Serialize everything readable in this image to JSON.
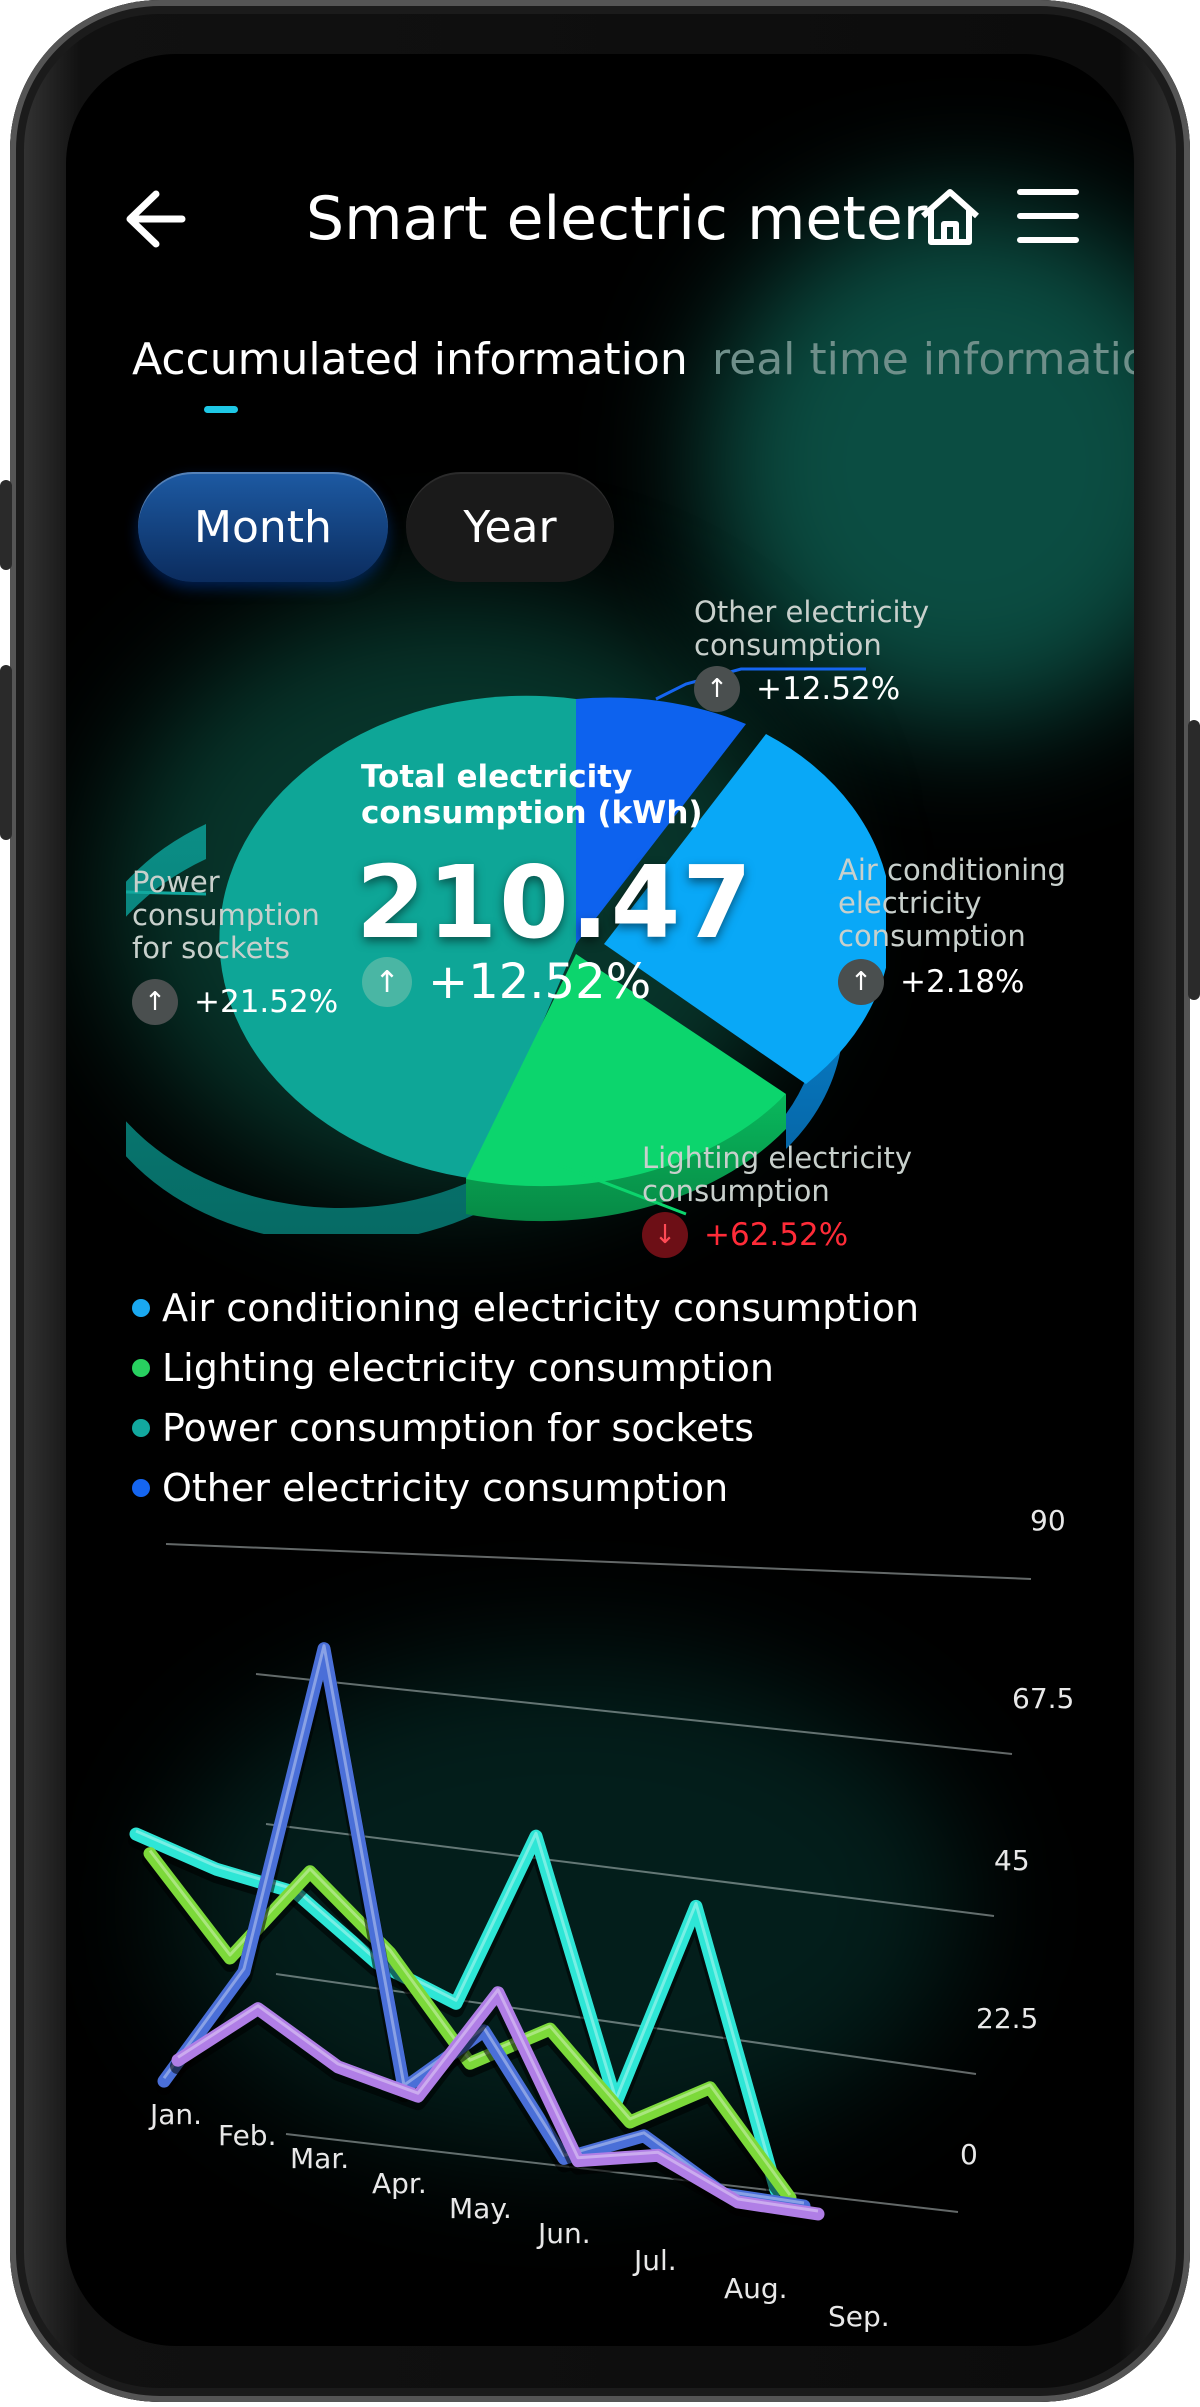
{
  "header": {
    "title": "Smart electric meter"
  },
  "tabs": [
    {
      "label": "Accumulated information",
      "active": true
    },
    {
      "label": "real time information",
      "active": false
    }
  ],
  "period": {
    "month_label": "Month",
    "year_label": "Year",
    "selected": "Month"
  },
  "summary": {
    "title_line1": "Total electricity",
    "title_line2": "consumption (kWh)",
    "value": "210.47",
    "change": "+12.52%"
  },
  "pie": {
    "segments": [
      {
        "name": "Other electricity consumption",
        "label_lines": [
          "Other electricity",
          "consumption"
        ],
        "change": "+12.52%",
        "trend": "up",
        "color": "#0f63f0",
        "share": 0.12
      },
      {
        "name": "Air conditioning electricity consumption",
        "label_lines": [
          "Air conditioning",
          "electricity",
          "consumption"
        ],
        "change": "+2.18%",
        "trend": "up",
        "color": "#08a8f8",
        "share": 0.25
      },
      {
        "name": "Lighting electricity consumption",
        "label_lines": [
          "Lighting electricity",
          "consumption"
        ],
        "change": "+62.52%",
        "trend": "down",
        "color": "#0cd66e",
        "share": 0.2
      },
      {
        "name": "Power consumption for sockets",
        "label_lines": [
          "Power",
          "consumption",
          "for sockets"
        ],
        "change": "+21.52%",
        "trend": "up",
        "color": "#0fa69a",
        "share": 0.43
      }
    ]
  },
  "legend": [
    {
      "label": "Air conditioning electricity consumption",
      "color": "#1aa8f0"
    },
    {
      "label": "Lighting electricity consumption",
      "color": "#28d060"
    },
    {
      "label": "Power consumption for sockets",
      "color": "#12a89e"
    },
    {
      "label": "Other electricity consumption",
      "color": "#1565f0"
    }
  ],
  "chart_data": {
    "type": "line",
    "categories": [
      "Jan.",
      "Feb.",
      "Mar.",
      "Apr.",
      "May.",
      "Jun.",
      "Jul.",
      "Aug.",
      "Sep."
    ],
    "y_ticks": [
      "90",
      "67.5",
      "45",
      "22.5",
      "0"
    ],
    "ylim": [
      0,
      90
    ],
    "series": [
      {
        "color": "#2ee6d6",
        "values": [
          45,
          41,
          39,
          29,
          24,
          55,
          11,
          47,
          0
        ]
      },
      {
        "color": "#7cd93a",
        "values": [
          43,
          27,
          44,
          32,
          15,
          23,
          9,
          17,
          0
        ]
      },
      {
        "color": "#4a6fd8",
        "values": [
          5,
          26,
          84,
          10,
          22,
          2,
          8,
          0,
          0
        ]
      },
      {
        "color": "#b07ee6",
        "values": [
          10,
          21,
          13,
          10,
          30,
          3,
          6,
          0,
          0
        ]
      }
    ]
  }
}
